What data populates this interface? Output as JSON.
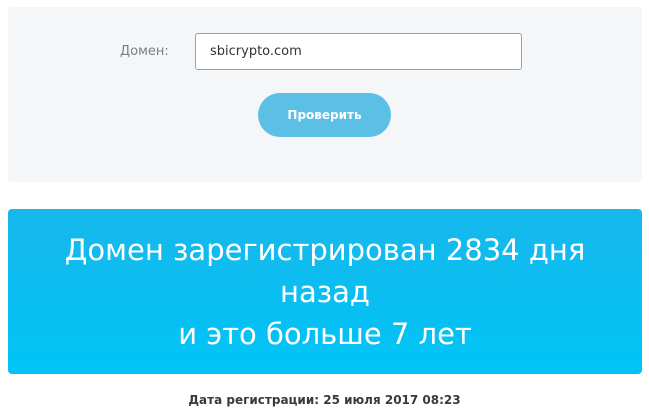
{
  "form": {
    "domain_label": "Домен:",
    "domain_value": "sbicrypto.com",
    "check_button_label": "Проверить"
  },
  "result": {
    "line1": "Домен зарегистрирован 2834 дня",
    "line2": "назад",
    "line3": "и это больше 7 лет"
  },
  "registration": {
    "text": "Дата регистрации: 25 июля 2017 08:23"
  },
  "colors": {
    "accent": "#5bbfe6",
    "banner": "#00c4f6",
    "panel": "#f4f6f7"
  }
}
